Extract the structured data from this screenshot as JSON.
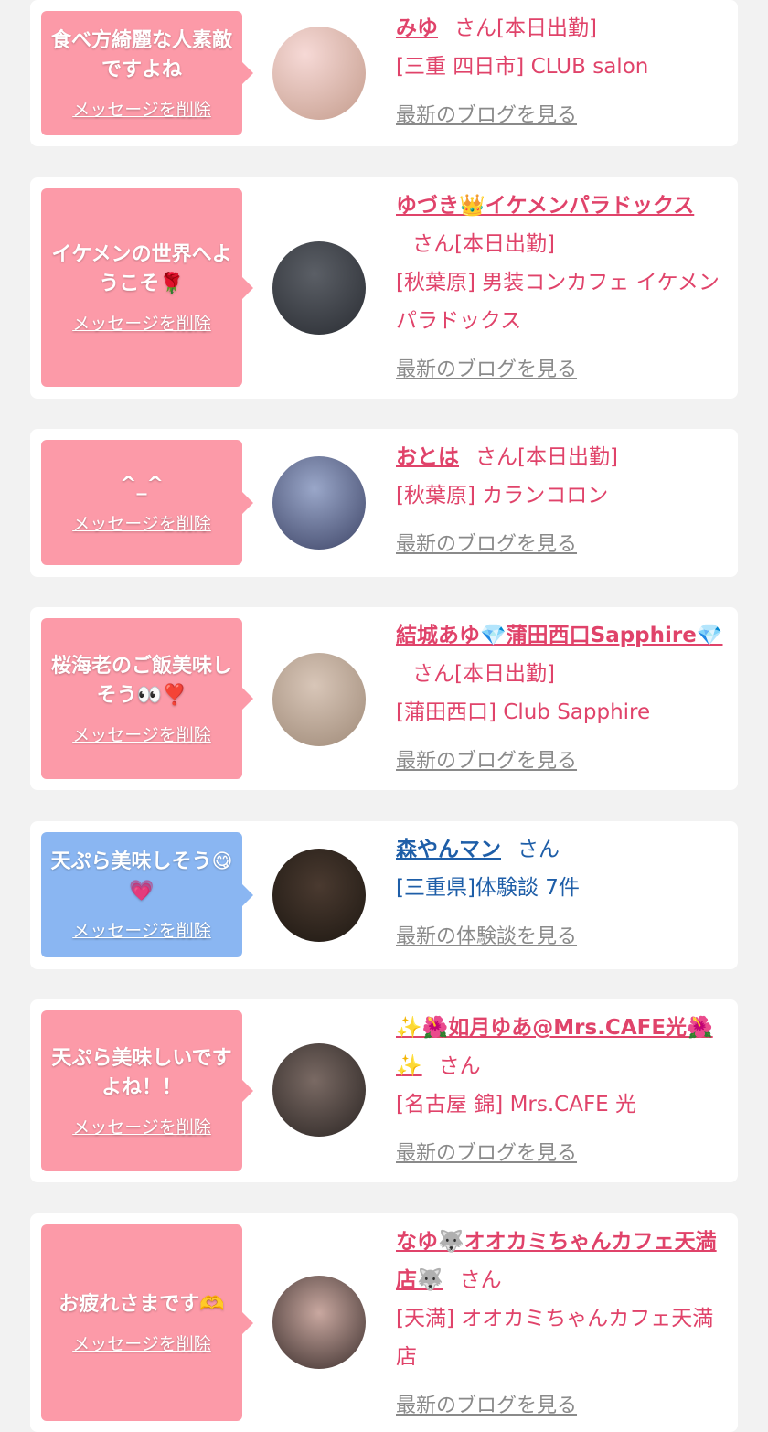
{
  "cards": [
    {
      "message": "食べ方綺麗な人素敵ですよね",
      "delete_label": "メッセージを削除",
      "name": "みゆ",
      "suffix": "さん[本日出勤]",
      "shop": "[三重 四日市] CLUB salon",
      "link": "最新のブログを見る",
      "bubble_color": "#fc9aa8",
      "avatar_colors": [
        "#f6d9d6",
        "#c49c8c"
      ]
    },
    {
      "message": "イケメンの世界へようこそ🌹",
      "delete_label": "メッセージを削除",
      "name": "ゆづき👑イケメンパラドックス",
      "suffix": "さん[本日出勤]",
      "shop": "[秋葉原] 男装コンカフェ イケメンパラドックス",
      "link": "最新のブログを見る",
      "bubble_color": "#fc9aa8",
      "avatar_colors": [
        "#5b5f66",
        "#2a2d33"
      ]
    },
    {
      "message": "^_^",
      "delete_label": "メッセージを削除",
      "name": "おとは",
      "suffix": "さん[本日出勤]",
      "shop": "[秋葉原] カランコロン",
      "link": "最新のブログを見る",
      "bubble_color": "#fc9aa8",
      "avatar_colors": [
        "#9aa7c9",
        "#3d4466"
      ]
    },
    {
      "message": "桜海老のご飯美味しそう👀❣️",
      "delete_label": "メッセージを削除",
      "name": "結城あゆ💎蒲田西口Sapphire💎",
      "suffix": "さん[本日出勤]",
      "shop": "[蒲田西口] Club Sapphire",
      "link": "最新のブログを見る",
      "bubble_color": "#fc9aa8",
      "avatar_colors": [
        "#d8c6b8",
        "#9f8a78"
      ]
    },
    {
      "message": "天ぷら美味しそう😋💗",
      "delete_label": "メッセージを削除",
      "name": "森やんマン",
      "suffix": "さん",
      "shop": "[三重県]体験談 7件",
      "link": "最新の体験談を見る",
      "bubble_color": "#8ab6f2",
      "avatar_colors": [
        "#4a3a30",
        "#1e1812"
      ]
    },
    {
      "message": "天ぷら美味しいですよね！！",
      "delete_label": "メッセージを削除",
      "name": "✨🌺如月ゆあ@Mrs.CAFE光🌺✨",
      "suffix": "さん",
      "shop": "[名古屋 錦] Mrs.CAFE 光",
      "link": "最新のブログを見る",
      "bubble_color": "#fc9aa8",
      "avatar_colors": [
        "#7a6a64",
        "#2b2523"
      ]
    },
    {
      "message": "お疲れさまです🫶",
      "delete_label": "メッセージを削除",
      "name": "なゆ🐺オオカミちゃんカフェ天満店🐺",
      "suffix": "さん",
      "shop": "[天満] オオカミちゃんカフェ天満店",
      "link": "最新のブログを見る",
      "bubble_color": "#fc9aa8",
      "avatar_colors": [
        "#c9a8a0",
        "#3b2e2c"
      ]
    }
  ]
}
